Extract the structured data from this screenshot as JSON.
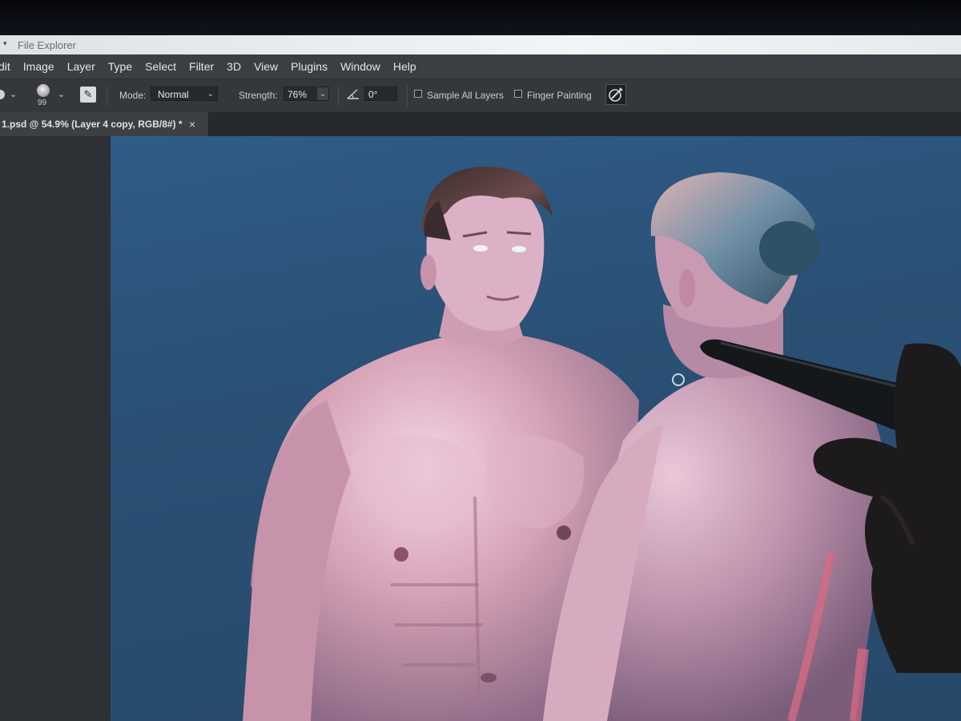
{
  "window": {
    "title": "File Explorer"
  },
  "menu": {
    "items": [
      "dit",
      "Image",
      "Layer",
      "Type",
      "Select",
      "Filter",
      "3D",
      "View",
      "Plugins",
      "Window",
      "Help"
    ]
  },
  "options": {
    "brush_size": "99",
    "mode_label": "Mode:",
    "mode_value": "Normal",
    "strength_label": "Strength:",
    "strength_value": "76%",
    "angle_value": "0°",
    "sample_all_layers_label": "Sample All Layers",
    "sample_all_layers_checked": false,
    "finger_painting_label": "Finger Painting",
    "finger_painting_checked": false
  },
  "document_tab": {
    "label": "1.psd @ 54.9% (Layer 4 copy, RGB/8#) *",
    "close": "×"
  },
  "colors": {
    "canvas_background": "#2c5479",
    "app_chrome": "#34383c",
    "menubar": "#3b3f44"
  },
  "icons": {
    "brush_panel": "brush-settings-icon",
    "angle": "angle-icon",
    "pressure": "pressure-strength-icon"
  }
}
